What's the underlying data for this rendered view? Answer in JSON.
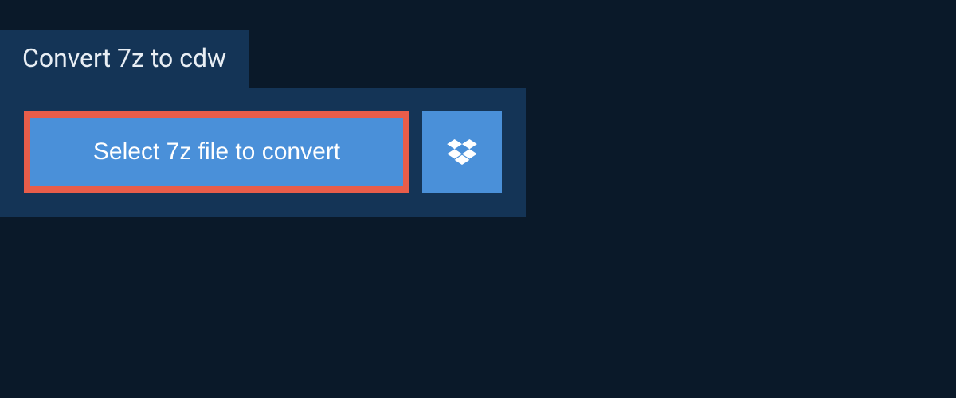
{
  "header": {
    "title": "Convert 7z to cdw"
  },
  "actions": {
    "select_file_label": "Select 7z file to convert"
  },
  "colors": {
    "background": "#0a1929",
    "panel": "#143456",
    "button": "#4a90d9",
    "highlight_border": "#e85d4a",
    "text": "#ffffff"
  }
}
